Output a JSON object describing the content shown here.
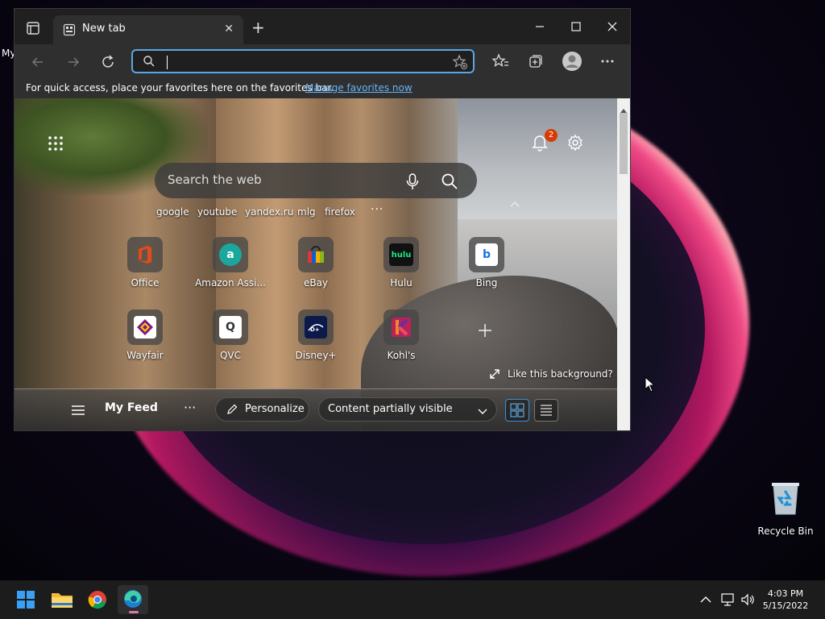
{
  "desktop": {
    "fragment": "My",
    "recycle_bin": "Recycle Bin"
  },
  "browser": {
    "tab_title": "New tab",
    "address_placeholder": "",
    "favorites_bar_text": "For quick access, place your favorites here on the favorites bar.",
    "favorites_bar_link": "Manage favorites now"
  },
  "ntp": {
    "notification_count": "2",
    "search_placeholder": "Search the web",
    "quick_links": [
      "google",
      "youtube",
      "yandex.ru",
      "mlg",
      "firefox"
    ],
    "more_links": "···",
    "tiles": [
      {
        "label": "Office",
        "color": "#d83b01",
        "icon": "office-icon"
      },
      {
        "label": "Amazon Assi...",
        "color": "#1aa89c",
        "icon": "amazon-assistant-icon"
      },
      {
        "label": "eBay",
        "color": "#2f2f2f",
        "icon": "ebay-icon"
      },
      {
        "label": "Hulu",
        "color": "#111111",
        "icon": "hulu-icon"
      },
      {
        "label": "Bing",
        "color": "#ffffff",
        "icon": "bing-icon"
      },
      {
        "label": "Wayfair",
        "color": "#7f187f",
        "icon": "wayfair-icon"
      },
      {
        "label": "QVC",
        "color": "#ffffff",
        "icon": "qvc-icon"
      },
      {
        "label": "Disney+",
        "color": "#0b1a4a",
        "icon": "disney-plus-icon"
      },
      {
        "label": "Kohl's",
        "color": "#8e1f4f",
        "icon": "kohls-icon"
      }
    ],
    "tile_glyphs": {
      "amazon": "a",
      "hulu": "hulu",
      "bing": "b",
      "qvc": "Q"
    },
    "like_background": "Like this background?",
    "feed": {
      "my_feed": "My Feed",
      "more": "···",
      "personalize": "Personalize",
      "content_visibility": "Content partially visible"
    }
  },
  "taskbar": {
    "time": "4:03 PM",
    "date": "5/15/2022"
  }
}
